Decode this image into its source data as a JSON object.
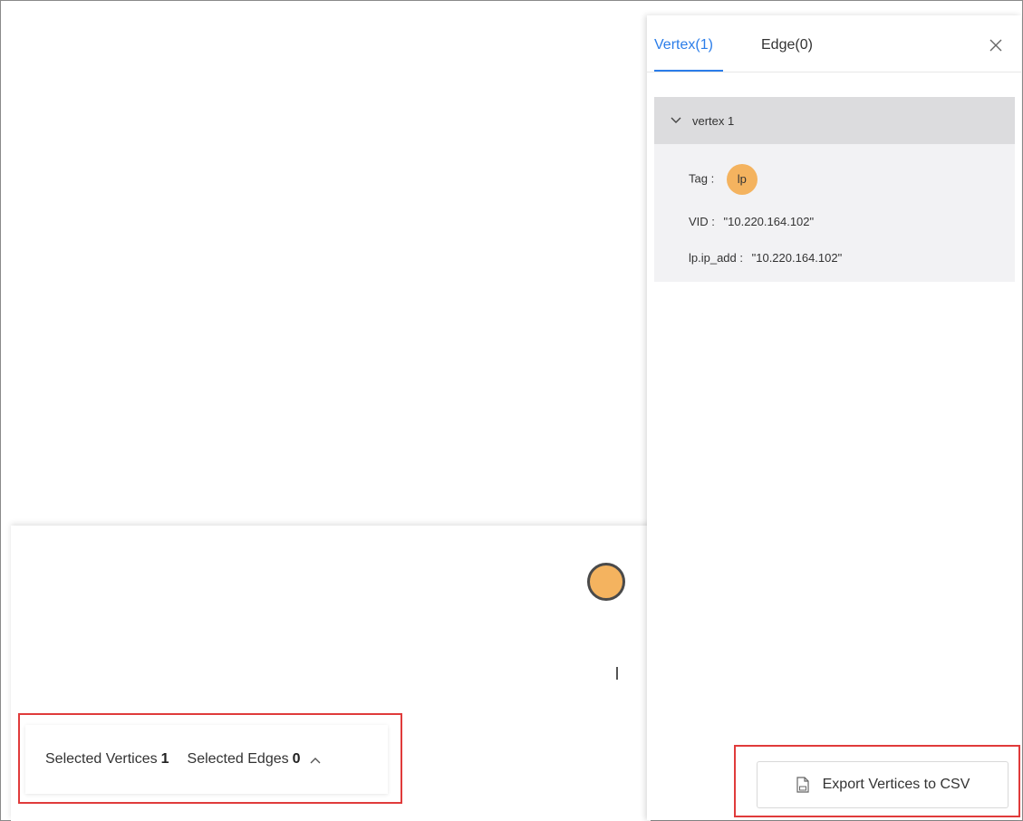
{
  "side_panel": {
    "tabs": [
      {
        "label": "Vertex(1)",
        "active": true
      },
      {
        "label": "Edge(0)",
        "active": false
      }
    ],
    "close_icon": "close-icon",
    "vertex": {
      "header": "vertex 1",
      "tag_label": "Tag :",
      "tag_value": "lp",
      "vid_label": "VID :",
      "vid_value": "\"10.220.164.102\"",
      "prop_label": "lp.ip_add :",
      "prop_value": "\"10.220.164.102\""
    },
    "export_button": "Export Vertices to CSV"
  },
  "status_bar": {
    "vertices_label": "Selected Vertices",
    "vertices_count": "1",
    "edges_label": "Selected Edges",
    "edges_count": "0"
  },
  "cursor_text": "I",
  "colors": {
    "accent": "#2b7de9",
    "node": "#f4b35f",
    "highlight": "#e03b3b"
  }
}
